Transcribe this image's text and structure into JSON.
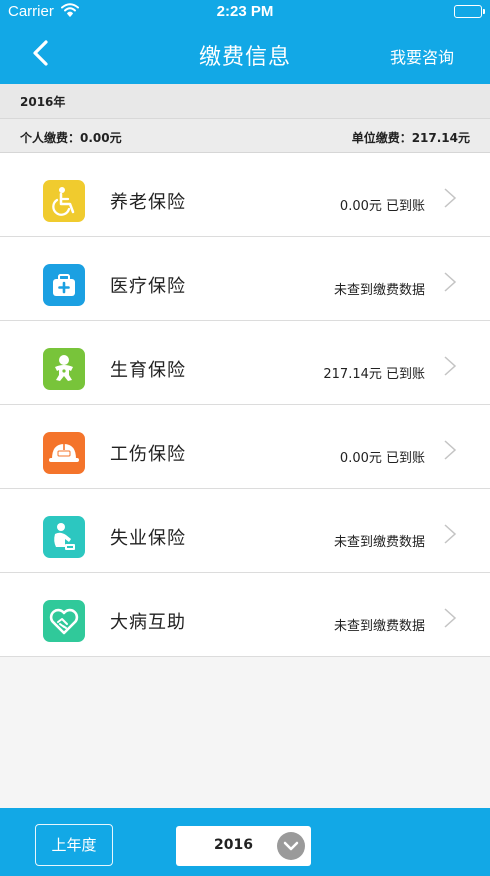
{
  "status_bar": {
    "carrier": "Carrier",
    "time": "2:23 PM"
  },
  "header": {
    "title": "缴费信息",
    "right_action": "我要咨询",
    "back_icon": "chevron-left-icon"
  },
  "year_label": "2016年",
  "summary": {
    "personal": "个人缴费：0.00元",
    "unit": "单位缴费：217.14元"
  },
  "insurance_items": [
    {
      "label": "养老保险",
      "status": "0.00元 已到账",
      "icon": "wheelchair-icon",
      "color": "#f0cb2e"
    },
    {
      "label": "医疗保险",
      "status": "未查到缴费数据",
      "icon": "medical-kit-icon",
      "color": "#1ba0e2"
    },
    {
      "label": "生育保险",
      "status": "217.14元 已到账",
      "icon": "baby-icon",
      "color": "#78c43a"
    },
    {
      "label": "工伤保险",
      "status": "0.00元 已到账",
      "icon": "safety-helmet-icon",
      "color": "#f4742b"
    },
    {
      "label": "失业保险",
      "status": "未查到缴费数据",
      "icon": "unemployed-person-icon",
      "color": "#2cc7c0"
    },
    {
      "label": "大病互助",
      "status": "未查到缴费数据",
      "icon": "heart-handshake-icon",
      "color": "#30c99a"
    }
  ],
  "footer": {
    "prev_year_button": "上年度",
    "year_select_value": "2016"
  },
  "colors": {
    "primary": "#12a8e6"
  }
}
